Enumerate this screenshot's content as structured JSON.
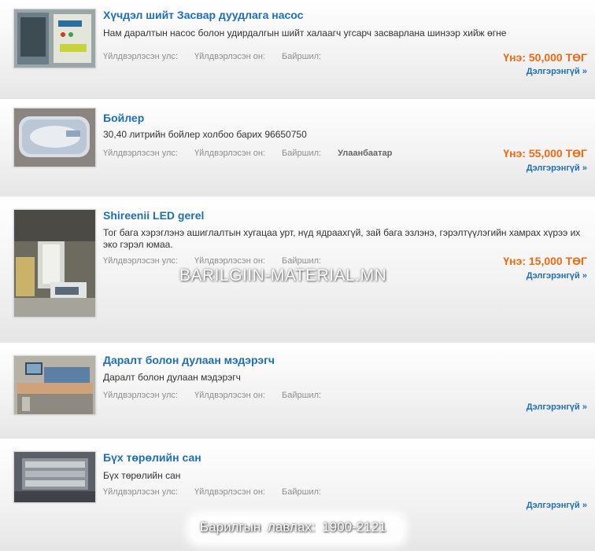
{
  "listings": [
    {
      "title": "Хүчдэл шийт Засвар дуудлага насос",
      "description": "Нам даралтын насос болон удирдалгын шийт халаагч угсарч засварлана шинээр хийж өгне",
      "meta_country_label": "Үйлдвэрлэсэн улс:",
      "meta_year_label": "Үйлдвэрлэсэн он:",
      "meta_location_label": "Байршил:",
      "meta_location_value": "",
      "price": "Үнэ: 50,000 ТӨГ",
      "more": "Дэлгэрэнгүй »"
    },
    {
      "title": "Бойлер",
      "description": "30,40 литрийн бойлер холбоо барих 96650750",
      "meta_country_label": "Үйлдвэрлэсэн улс:",
      "meta_year_label": "Үйлдвэрлэсэн он:",
      "meta_location_label": "Байршил:",
      "meta_location_value": "Улаанбаатар",
      "price": "Үнэ: 55,000 ТӨГ",
      "more": "Дэлгэрэнгүй »"
    },
    {
      "title": "Shireenii LED gerel",
      "description": "Тог бага хэрэглэнэ ашиглалтын хугацаа урт, нүд ядраахгүй, зай бага эзлэнэ, гэрэлтүүлэгийн хамрах хүрээ их эко гэрэл юмаа.",
      "meta_country_label": "Үйлдвэрлэсэн улс:",
      "meta_year_label": "Үйлдвэрлэсэн он:",
      "meta_location_label": "Байршил:",
      "meta_location_value": "",
      "price": "Үнэ: 15,000 ТӨГ",
      "more": "Дэлгэрэнгүй »"
    },
    {
      "title": "Даралт болон дулаан мэдэрэгч",
      "description": "Даралт болон дулаан мэдэрэгч",
      "meta_country_label": "Үйлдвэрлэсэн улс:",
      "meta_year_label": "Үйлдвэрлэсэн он:",
      "meta_location_label": "Байршил:",
      "meta_location_value": "",
      "price": "",
      "more": "Дэлгэрэнгүй »"
    },
    {
      "title": "Бүх төрөлийн сан",
      "description": "Бүх төрөлийн сан",
      "meta_country_label": "Үйлдвэрлэсэн улс:",
      "meta_year_label": "Үйлдвэрлэсэн он:",
      "meta_location_label": "Байршил:",
      "meta_location_value": "",
      "price": "",
      "more": "Дэлгэрэнгүй »"
    }
  ],
  "watermark": "BARILGIIN-MATERIAL.MN",
  "footer": "Барилгын лавлах: 1900-2121",
  "colors": {
    "title": "#1f6fb8",
    "price": "#ee6a12",
    "meta": "#8e8e8e"
  },
  "icons": [
    "thumbnail-control-panel",
    "thumbnail-boiler",
    "thumbnail-led-light",
    "thumbnail-sensor-console",
    "thumbnail-warehouse"
  ]
}
